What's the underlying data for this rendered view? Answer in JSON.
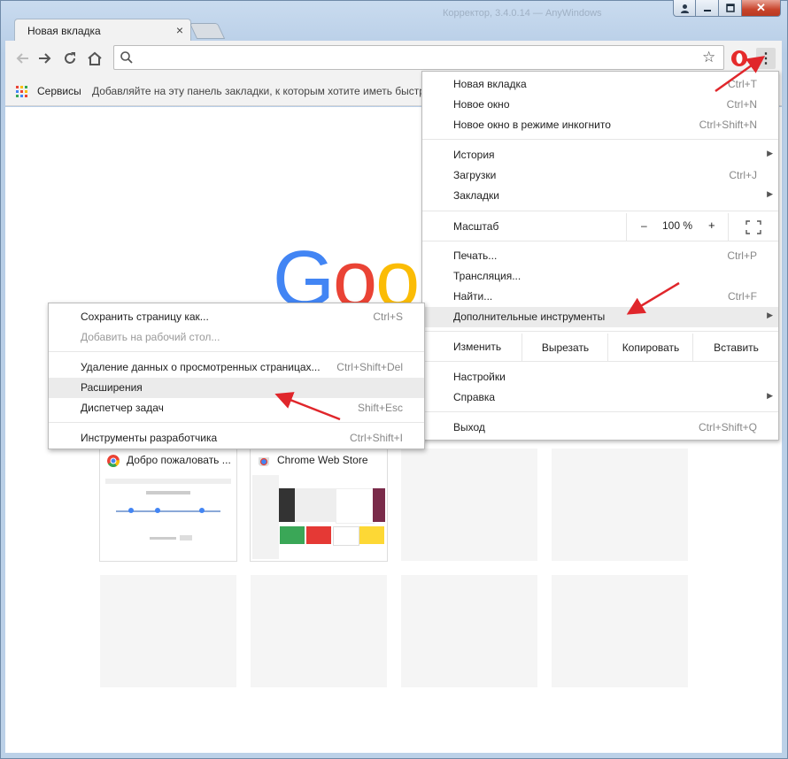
{
  "window": {
    "title_hint": "Корректор, 3.4.0.14 — AnyWindows",
    "controls": [
      "user",
      "minimize",
      "maximize",
      "close"
    ]
  },
  "tab": {
    "title": "Новая вкладка",
    "close_glyph": "×"
  },
  "toolbar": {
    "back_icon": "arrow-left-icon",
    "forward_icon": "arrow-right-icon",
    "reload_icon": "reload-icon",
    "home_icon": "home-icon",
    "omnibox_value": "",
    "star_icon": "star-icon",
    "extension_icon": "opera-icon",
    "menu_icon": "kebab-menu-icon"
  },
  "bookmarks": {
    "apps_label": "Сервисы",
    "hint": "Добавляйте на эту панель закладки, к которым хотите иметь быстр"
  },
  "ntp": {
    "logo": "Goo",
    "tiles": [
      {
        "title": "Добро пожаловать ..."
      },
      {
        "title": "Chrome Web Store"
      }
    ]
  },
  "menu": {
    "new_tab": {
      "label": "Новая вкладка",
      "shortcut": "Ctrl+T"
    },
    "new_window": {
      "label": "Новое окно",
      "shortcut": "Ctrl+N"
    },
    "incognito": {
      "label": "Новое окно в режиме инкогнито",
      "shortcut": "Ctrl+Shift+N"
    },
    "history": {
      "label": "История"
    },
    "downloads": {
      "label": "Загрузки",
      "shortcut": "Ctrl+J"
    },
    "bookmarks": {
      "label": "Закладки"
    },
    "zoom": {
      "label": "Масштаб",
      "minus": "–",
      "value": "100 %",
      "plus": "+"
    },
    "print": {
      "label": "Печать...",
      "shortcut": "Ctrl+P"
    },
    "cast": {
      "label": "Трансляция..."
    },
    "find": {
      "label": "Найти...",
      "shortcut": "Ctrl+F"
    },
    "more_tools": {
      "label": "Дополнительные инструменты"
    },
    "edit": {
      "label": "Изменить",
      "cut": "Вырезать",
      "copy": "Копировать",
      "paste": "Вставить"
    },
    "settings": {
      "label": "Настройки"
    },
    "help": {
      "label": "Справка"
    },
    "exit": {
      "label": "Выход",
      "shortcut": "Ctrl+Shift+Q"
    }
  },
  "submenu": {
    "save_page": {
      "label": "Сохранить страницу как...",
      "shortcut": "Ctrl+S"
    },
    "add_desktop": {
      "label": "Добавить на рабочий стол..."
    },
    "clear_data": {
      "label": "Удаление данных о просмотренных страницах...",
      "shortcut": "Ctrl+Shift+Del"
    },
    "extensions": {
      "label": "Расширения"
    },
    "task_manager": {
      "label": "Диспетчер задач",
      "shortcut": "Shift+Esc"
    },
    "dev_tools": {
      "label": "Инструменты разработчика",
      "shortcut": "Ctrl+Shift+I"
    }
  },
  "colors": {
    "annotation_arrow": "#e0262b",
    "google_blue": "#4285f4",
    "google_red": "#ea4335",
    "google_yellow": "#fbbc05",
    "highlight": "#ebebeb"
  }
}
